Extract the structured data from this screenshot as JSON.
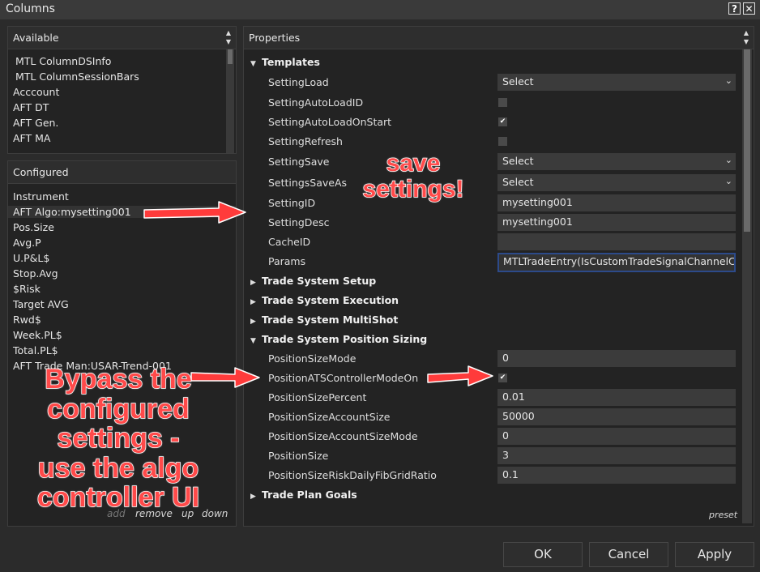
{
  "window": {
    "title": "Columns",
    "help_label": "?",
    "close_label": "✕"
  },
  "available": {
    "header": "Available",
    "items": [
      "MTL ColumnDSInfo",
      "MTL ColumnSessionBars",
      "Acccount",
      "AFT DT",
      "AFT Gen.",
      "AFT MA"
    ]
  },
  "configured": {
    "header": "Configured",
    "items": [
      "Instrument",
      "AFT Algo:mysetting001",
      "Pos.Size",
      "Avg.P",
      "U.P&L$",
      "Stop.Avg",
      "$Risk",
      "Target AVG",
      "Rwd$",
      "Week.PL$",
      "Total.PL$",
      "AFT Trade Man:USAR-Trend-001"
    ],
    "actions": {
      "add": "add",
      "remove": "remove",
      "up": "up",
      "down": "down"
    }
  },
  "properties": {
    "header": "Properties",
    "preset": "preset",
    "sections": {
      "templates": "Templates",
      "trade_system_setup": "Trade System Setup",
      "trade_system_execution": "Trade System Execution",
      "trade_system_multishot": "Trade System MultiShot",
      "trade_system_position_sizing": "Trade System Position Sizing",
      "trade_plan_goals": "Trade Plan Goals"
    },
    "templates": {
      "setting_load": {
        "label": "SettingLoad",
        "value": "Select"
      },
      "setting_auto_load_id": {
        "label": "SettingAutoLoadID",
        "checked": false
      },
      "setting_auto_load_on_start": {
        "label": "SettingAutoLoadOnStart",
        "checked": true,
        "mark": "✔"
      },
      "setting_refresh": {
        "label": "SettingRefresh",
        "checked": false
      },
      "setting_save": {
        "label": "SettingSave",
        "value": "Select"
      },
      "settings_save_as": {
        "label": "SettingsSaveAs",
        "value": "Select"
      },
      "setting_id": {
        "label": "SettingID",
        "value": "mysetting001"
      },
      "setting_desc": {
        "label": "SettingDesc",
        "value": "mysetting001"
      },
      "cache_id": {
        "label": "CacheID",
        "value": ""
      },
      "params": {
        "label": "Params",
        "value": "MTLTradeEntry(IsCustomTradeSignalChannelC"
      }
    },
    "position_sizing": {
      "mode": {
        "label": "PositionSizeMode",
        "value": "0"
      },
      "ats_controller_mode_on": {
        "label": "PositionATSControllerModeOn",
        "checked": true,
        "mark": "✔"
      },
      "percent": {
        "label": "PositionSizePercent",
        "value": "0.01"
      },
      "account_size": {
        "label": "PositionSizeAccountSize",
        "value": "50000"
      },
      "account_size_mode": {
        "label": "PositionSizeAccountSizeMode",
        "value": "0"
      },
      "size": {
        "label": "PositionSize",
        "value": "3"
      },
      "risk_daily_fib_grid_ratio": {
        "label": "PositionSizeRiskDailyFibGridRatio",
        "value": "0.1"
      }
    }
  },
  "buttons": {
    "ok": "OK",
    "cancel": "Cancel",
    "apply": "Apply"
  },
  "annotations": {
    "save_settings": [
      "save",
      "settings!"
    ],
    "bypass": [
      "Bypass the",
      "configured",
      "settings  -",
      "use the algo",
      "controller UI"
    ],
    "color": "#ff3b3b"
  },
  "icons": {
    "expanded": "triangle-down-icon",
    "collapsed": "triangle-right-icon",
    "dropdown": "chevron-down-icon",
    "check": "checkmark-icon"
  }
}
